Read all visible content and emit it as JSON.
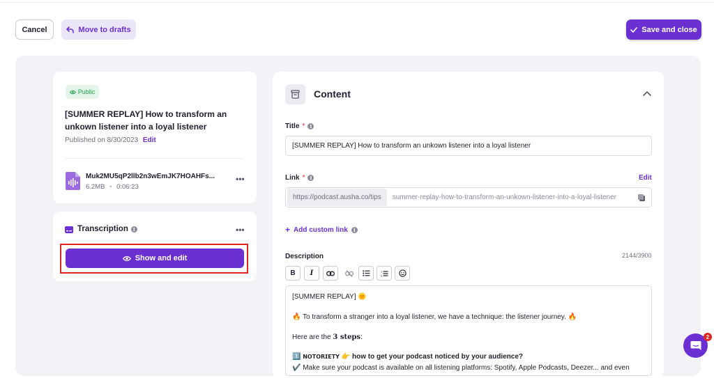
{
  "header": {
    "cancel_label": "Cancel",
    "drafts_label": "Move to drafts",
    "save_label": "Save and close"
  },
  "episode": {
    "visibility": "Public",
    "title": "[SUMMER REPLAY] How to transform an unkown listener into a loyal listener",
    "published": "Published on 8/30/2023",
    "edit_label": "Edit",
    "file_name": "Muk2MU5qP2llb2n3wEmJK7HOAHFs...",
    "file_size": "6.2MB",
    "file_duration": "0:06:23",
    "more_icon": "more-icon"
  },
  "transcription": {
    "title": "Transcription",
    "button_label": "Show and edit"
  },
  "content": {
    "heading": "Content",
    "title_label": "Title",
    "title_value": "[SUMMER REPLAY] How to transform an unkown listener into a loyal listener",
    "link_label": "Link",
    "link_edit": "Edit",
    "link_prefix": "https://podcast.ausha.co/tips",
    "link_slug": "summer-replay-how-to-transform-an-unkown-listener-into-a-loyal-listener",
    "add_custom_link": "Add custom link",
    "description_label": "Description",
    "char_count": "2144/3900",
    "toolbar": {
      "bold": "B",
      "italic": "I"
    },
    "description_lines": {
      "line1": "[SUMMER REPLAY] 🌞",
      "line2": "🔥 To transform a stranger into a loyal listener, we have a technique: the listener journey. 🔥",
      "line3_pre": "Here are the ",
      "line3_bold": "3 steps",
      "line3_post": ":",
      "line4_num": "1️⃣",
      "line4_tag": "𝗡𝗢𝗧𝗢𝗥𝗜𝗘𝗧𝗬",
      "line4_text": "how to get your podcast noticed by your audience?",
      "line5": "✔️ Make sure your podcast is available on all listening platforms: Spotify, Apple Podcasts, Deezer... and even"
    }
  },
  "chat": {
    "badge_count": "2"
  },
  "colors": {
    "brand": "#6c2fd1",
    "public_green": "#1e9e4a",
    "highlight_red": "#e0241f"
  }
}
